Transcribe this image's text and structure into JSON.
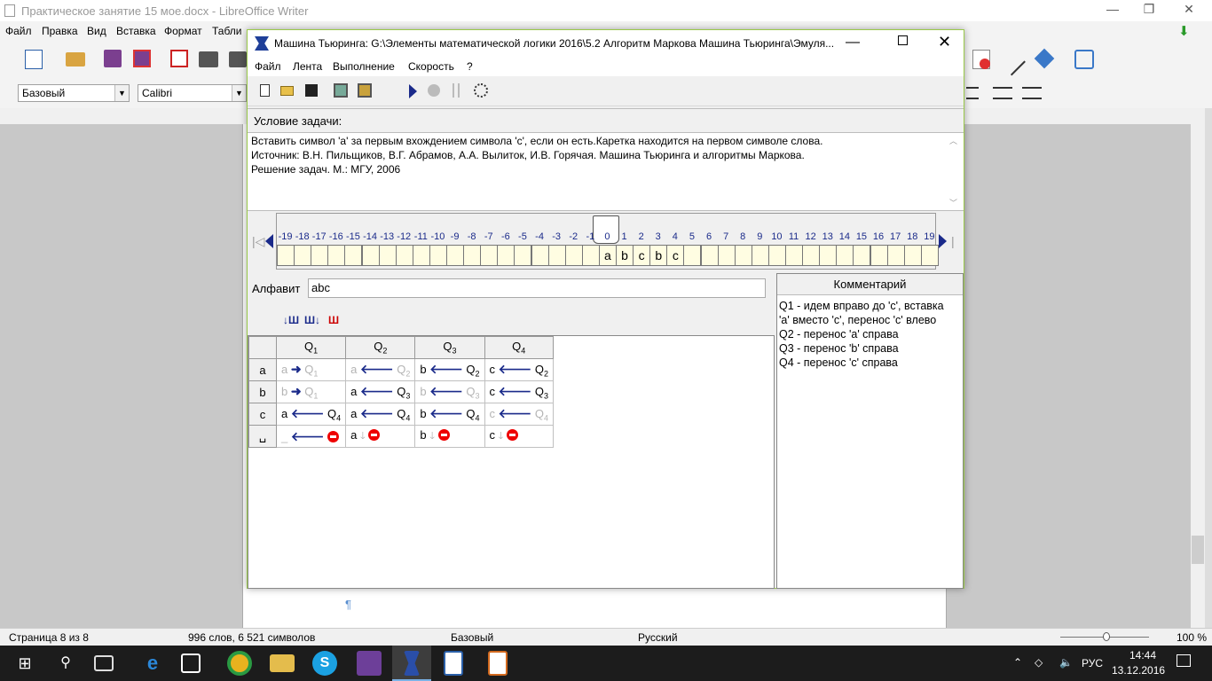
{
  "writer": {
    "title": "Практическое занятие 15 мое.docx - LibreOffice Writer",
    "menu": [
      "Файл",
      "Правка",
      "Вид",
      "Вставка",
      "Формат",
      "Табли"
    ],
    "style_combo": "Базовый",
    "font_combo": "Calibri",
    "pilcrow": "¶",
    "status": {
      "page": "Страница 8 из 8",
      "words": "996 слов, 6 521 символов",
      "style": "Базовый",
      "lang": "Русский",
      "zoom": "100 %"
    }
  },
  "dialog": {
    "title": "Машина Тьюринга: G:\\Элементы математической логики 2016\\5.2 Алгоритм Маркова Машина Тьюринга\\Эмуля...",
    "menu": [
      "Файл",
      "Лента",
      "Выполнение",
      "Скорость",
      "?"
    ],
    "condition_label": "Условие задачи:",
    "condition_lines": [
      "Вставить символ 'а' за первым вхождением символа 'с', если он есть.Каретка находится на первом символе слова.",
      "Источник: В.Н. Пильщиков, В.Г. Абрамов, А.А. Вылиток, И.В. Горячая. Машина Тьюринга и алгоритмы Маркова.",
      "Решение задач. М.: МГУ, 2006"
    ],
    "tape_indices": [
      "-19",
      "-18",
      "-17",
      "-16",
      "-15",
      "-14",
      "-13",
      "-12",
      "-11",
      "-10",
      "-9",
      "-8",
      "-7",
      "-6",
      "-5",
      "-4",
      "-3",
      "-2",
      "-1",
      "0",
      "1",
      "2",
      "3",
      "4",
      "5",
      "6",
      "7",
      "8",
      "9",
      "10",
      "11",
      "12",
      "13",
      "14",
      "15",
      "16",
      "17",
      "18",
      "19"
    ],
    "tape_cells": [
      "",
      "",
      "",
      "",
      "",
      "",
      "",
      "",
      "",
      "",
      "",
      "",
      "",
      "",
      "",
      "",
      "",
      "",
      "",
      "a",
      "b",
      "c",
      "b",
      "c",
      "",
      "",
      "",
      "",
      "",
      "",
      "",
      "",
      "",
      "",
      "",
      "",
      "",
      "",
      ""
    ],
    "alphabet_label": "Алфавит",
    "alphabet_value": "abc",
    "comment_label": "Комментарий",
    "comment_lines": [
      "Q1 - идем вправо до 'с', вставка",
      "'а' вместо 'с', перенос 'с' влево",
      "Q2 - перенос 'а' справа",
      "Q3 - перенос 'b' справа",
      "Q4 - перенос 'с' справа"
    ],
    "states": [
      "1",
      "2",
      "3",
      "4"
    ],
    "state_prefix": "Q",
    "rows": [
      {
        "sym": "a",
        "cells": [
          {
            "w": "a",
            "m": "right",
            "q": "1",
            "dim": true
          },
          {
            "w": "a",
            "m": "left",
            "q": "2",
            "dim": true
          },
          {
            "w": "b",
            "m": "left",
            "q": "2",
            "dim": false
          },
          {
            "w": "c",
            "m": "left",
            "q": "2",
            "dim": false
          }
        ]
      },
      {
        "sym": "b",
        "cells": [
          {
            "w": "b",
            "m": "right",
            "q": "1",
            "dim": true
          },
          {
            "w": "a",
            "m": "left",
            "q": "3",
            "dim": false
          },
          {
            "w": "b",
            "m": "left",
            "q": "3",
            "dim": true
          },
          {
            "w": "c",
            "m": "left",
            "q": "3",
            "dim": false
          }
        ]
      },
      {
        "sym": "c",
        "cells": [
          {
            "w": "a",
            "m": "left",
            "q": "4",
            "dim": false
          },
          {
            "w": "a",
            "m": "left",
            "q": "4",
            "dim": false
          },
          {
            "w": "b",
            "m": "left",
            "q": "4",
            "dim": false
          },
          {
            "w": "c",
            "m": "left",
            "q": "4",
            "dim": true
          }
        ]
      },
      {
        "sym": "␣",
        "cells": [
          {
            "w": "_",
            "m": "left",
            "q": "stop",
            "dim": true
          },
          {
            "w": "a",
            "m": "stay",
            "q": "stop",
            "dim": false
          },
          {
            "w": "b",
            "m": "stay",
            "q": "stop",
            "dim": false
          },
          {
            "w": "c",
            "m": "stay",
            "q": "stop",
            "dim": false
          }
        ]
      }
    ]
  },
  "taskbar": {
    "lang": "РУС",
    "time": "14:44",
    "date": "13.12.2016"
  }
}
